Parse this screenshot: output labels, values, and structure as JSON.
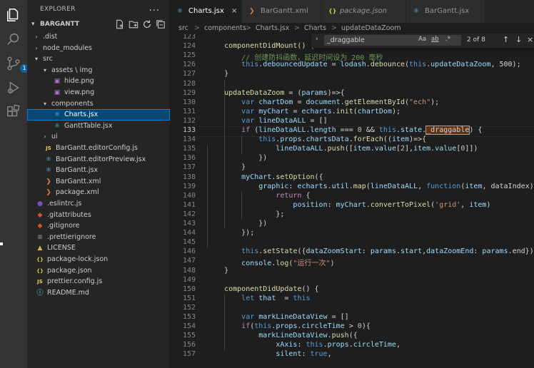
{
  "activity_bar": {
    "icons": [
      "files-icon",
      "search-icon",
      "source-control-icon",
      "run-debug-icon",
      "extensions-icon"
    ],
    "scm_badge": "1"
  },
  "explorer": {
    "title": "EXPLORER",
    "more": "...",
    "project": "BARGANTT",
    "items": [
      {
        "name": ".dist",
        "type": "folder",
        "expanded": false,
        "level": 1
      },
      {
        "name": "node_modules",
        "type": "folder",
        "expanded": false,
        "level": 1
      },
      {
        "name": "src",
        "type": "folder",
        "expanded": true,
        "level": 1
      },
      {
        "name": "assets \\ img",
        "type": "folder",
        "expanded": true,
        "level": 2
      },
      {
        "name": "hide.png",
        "type": "png",
        "level": 3
      },
      {
        "name": "view.png",
        "type": "png",
        "level": 3
      },
      {
        "name": "components",
        "type": "folder",
        "expanded": true,
        "level": 2
      },
      {
        "name": "Charts.jsx",
        "type": "jsx",
        "level": 3,
        "selected": true
      },
      {
        "name": "GanttTable.jsx",
        "type": "jsx",
        "level": 3
      },
      {
        "name": "ui",
        "type": "folder",
        "expanded": false,
        "level": 2
      },
      {
        "name": "BarGantt.editorConfig.js",
        "type": "js",
        "level": 2
      },
      {
        "name": "BarGantt.editorPreview.jsx",
        "type": "jsx",
        "level": 2
      },
      {
        "name": "BarGantt.jsx",
        "type": "jsx",
        "level": 2
      },
      {
        "name": "BarGantt.xml",
        "type": "xml",
        "level": 2
      },
      {
        "name": "package.xml",
        "type": "xml",
        "level": 2
      },
      {
        "name": ".eslintrc.js",
        "type": "eslint",
        "level": 1
      },
      {
        "name": ".gitattributes",
        "type": "git",
        "level": 1
      },
      {
        "name": ".gitignore",
        "type": "git",
        "level": 1
      },
      {
        "name": ".prettierignore",
        "type": "plain",
        "level": 1
      },
      {
        "name": "LICENSE",
        "type": "license",
        "level": 1
      },
      {
        "name": "package-lock.json",
        "type": "json",
        "level": 1
      },
      {
        "name": "package.json",
        "type": "json",
        "level": 1
      },
      {
        "name": "prettier.config.js",
        "type": "js",
        "level": 1
      },
      {
        "name": "README.md",
        "type": "md",
        "level": 1
      }
    ]
  },
  "tabs": [
    {
      "label": "Charts.jsx",
      "icon": "jsx",
      "active": true,
      "close": "×"
    },
    {
      "label": "BarGantt.xml",
      "icon": "xml",
      "active": false
    },
    {
      "label": "package.json",
      "icon": "json",
      "active": false,
      "italic": true
    },
    {
      "label": "BarGantt.jsx",
      "icon": "jsx",
      "active": false
    }
  ],
  "breadcrumb": [
    "src",
    ">",
    "components",
    ">",
    "Charts.jsx",
    ">",
    "Charts",
    ">",
    "updateDataZoom"
  ],
  "find_widget": {
    "value": "_draggable",
    "options": [
      "Aa",
      "ab",
      ".*"
    ],
    "count": "2 of 8",
    "prev": "↑",
    "next": "↓",
    "close": "×"
  },
  "editor": {
    "current_line": "133",
    "lines": [
      {
        "n": "123",
        "t": []
      },
      {
        "n": "124",
        "t": [
          [
            "    componentDidMount() {",
            "fn"
          ]
        ]
      },
      {
        "n": "125",
        "t": [
          [
            "        // 创建防抖函数，延迟时间设为 200 毫秒",
            "cm"
          ]
        ]
      },
      {
        "n": "126",
        "t": [
          [
            "        ",
            "pl"
          ],
          [
            "this",
            "kw"
          ],
          [
            ".",
            "pl"
          ],
          [
            "debouncedUpdate",
            "va"
          ],
          [
            " = ",
            "pl"
          ],
          [
            "lodash",
            "va"
          ],
          [
            ".",
            "pl"
          ],
          [
            "debounce",
            "fn"
          ],
          [
            "(",
            "pl"
          ],
          [
            "this",
            "kw"
          ],
          [
            ".",
            "pl"
          ],
          [
            "updateDataZoom",
            "va"
          ],
          [
            ", 500);",
            "pl"
          ]
        ]
      },
      {
        "n": "127",
        "t": [
          [
            "    }",
            "pl"
          ]
        ]
      },
      {
        "n": "128",
        "t": []
      },
      {
        "n": "129",
        "t": [
          [
            "    ",
            "pl"
          ],
          [
            "updateDataZoom",
            "fn"
          ],
          [
            " = (",
            "pl"
          ],
          [
            "params",
            "va"
          ],
          [
            ")=>{",
            "pl"
          ]
        ]
      },
      {
        "n": "130",
        "t": [
          [
            "        ",
            "pl"
          ],
          [
            "var",
            "kw"
          ],
          [
            " ",
            "pl"
          ],
          [
            "chartDom",
            "va"
          ],
          [
            " = ",
            "pl"
          ],
          [
            "document",
            "va"
          ],
          [
            ".",
            "pl"
          ],
          [
            "getElementById",
            "fn"
          ],
          [
            "(",
            "pl"
          ],
          [
            "\"ech\"",
            "st"
          ],
          [
            ");",
            "pl"
          ]
        ]
      },
      {
        "n": "131",
        "t": [
          [
            "        ",
            "pl"
          ],
          [
            "var",
            "kw"
          ],
          [
            " ",
            "pl"
          ],
          [
            "myChart",
            "va"
          ],
          [
            " = ",
            "pl"
          ],
          [
            "echarts",
            "va"
          ],
          [
            ".",
            "pl"
          ],
          [
            "init",
            "fn"
          ],
          [
            "(",
            "pl"
          ],
          [
            "chartDom",
            "va"
          ],
          [
            ");",
            "pl"
          ]
        ]
      },
      {
        "n": "132",
        "t": [
          [
            "        ",
            "pl"
          ],
          [
            "var",
            "kw"
          ],
          [
            " ",
            "pl"
          ],
          [
            "lineDataALL",
            "va"
          ],
          [
            " = []",
            "pl"
          ]
        ]
      },
      {
        "n": "133",
        "t": [
          [
            "        ",
            "pl"
          ],
          [
            "if",
            "ctl"
          ],
          [
            " (",
            "pl"
          ],
          [
            "lineDataALL",
            "va"
          ],
          [
            ".",
            "pl"
          ],
          [
            "length",
            "va"
          ],
          [
            " === ",
            "pl"
          ],
          [
            "0",
            "nu"
          ],
          [
            " && ",
            "pl"
          ],
          [
            "this",
            "kw"
          ],
          [
            ".",
            "pl"
          ],
          [
            "state",
            "va"
          ],
          [
            ".",
            "pl"
          ],
          [
            "_draggable",
            "match"
          ],
          [
            ") {",
            "pl"
          ]
        ]
      },
      {
        "n": "134",
        "t": [
          [
            "            ",
            "pl"
          ],
          [
            "this",
            "kw"
          ],
          [
            ".",
            "pl"
          ],
          [
            "props",
            "va"
          ],
          [
            ".",
            "pl"
          ],
          [
            "chartsData",
            "va"
          ],
          [
            ".",
            "pl"
          ],
          [
            "forEach",
            "fn"
          ],
          [
            "((",
            "pl"
          ],
          [
            "item",
            "va"
          ],
          [
            ")=>{",
            "pl"
          ]
        ]
      },
      {
        "n": "135",
        "t": [
          [
            "                ",
            "pl"
          ],
          [
            "lineDataALL",
            "va"
          ],
          [
            ".",
            "pl"
          ],
          [
            "push",
            "fn"
          ],
          [
            "([",
            "pl"
          ],
          [
            "item",
            "va"
          ],
          [
            ".",
            "pl"
          ],
          [
            "value",
            "va"
          ],
          [
            "[",
            "pl"
          ],
          [
            "2",
            "nu"
          ],
          [
            "],",
            "pl"
          ],
          [
            "item",
            "va"
          ],
          [
            ".",
            "pl"
          ],
          [
            "value",
            "va"
          ],
          [
            "[",
            "pl"
          ],
          [
            "0",
            "nu"
          ],
          [
            "]])",
            "pl"
          ]
        ]
      },
      {
        "n": "136",
        "t": [
          [
            "            })",
            "pl"
          ]
        ]
      },
      {
        "n": "137",
        "t": [
          [
            "        }",
            "pl"
          ]
        ]
      },
      {
        "n": "138",
        "t": [
          [
            "        ",
            "pl"
          ],
          [
            "myChart",
            "va"
          ],
          [
            ".",
            "pl"
          ],
          [
            "setOption",
            "fn"
          ],
          [
            "({",
            "pl"
          ]
        ]
      },
      {
        "n": "139",
        "t": [
          [
            "            ",
            "pl"
          ],
          [
            "graphic",
            "va"
          ],
          [
            ": ",
            "pl"
          ],
          [
            "echarts",
            "va"
          ],
          [
            ".",
            "pl"
          ],
          [
            "util",
            "va"
          ],
          [
            ".",
            "pl"
          ],
          [
            "map",
            "fn"
          ],
          [
            "(",
            "pl"
          ],
          [
            "lineDataALL",
            "va"
          ],
          [
            ", ",
            "pl"
          ],
          [
            "function",
            "kw"
          ],
          [
            "(",
            "pl"
          ],
          [
            "item",
            "va"
          ],
          [
            ", dataIndex) {",
            "pl"
          ]
        ]
      },
      {
        "n": "140",
        "t": [
          [
            "                ",
            "pl"
          ],
          [
            "return",
            "ctl"
          ],
          [
            " {",
            "pl"
          ]
        ]
      },
      {
        "n": "141",
        "t": [
          [
            "                    ",
            "pl"
          ],
          [
            "position",
            "va"
          ],
          [
            ": ",
            "pl"
          ],
          [
            "myChart",
            "va"
          ],
          [
            ".",
            "pl"
          ],
          [
            "convertToPixel",
            "fn"
          ],
          [
            "(",
            "pl"
          ],
          [
            "'grid'",
            "st"
          ],
          [
            ", ",
            "pl"
          ],
          [
            "item",
            "va"
          ],
          [
            ")",
            "pl"
          ]
        ]
      },
      {
        "n": "142",
        "t": [
          [
            "                };",
            "pl"
          ]
        ]
      },
      {
        "n": "143",
        "t": [
          [
            "            })",
            "pl"
          ]
        ]
      },
      {
        "n": "144",
        "t": [
          [
            "        });",
            "pl"
          ]
        ]
      },
      {
        "n": "145",
        "t": []
      },
      {
        "n": "146",
        "t": [
          [
            "        ",
            "pl"
          ],
          [
            "this",
            "kw"
          ],
          [
            ".",
            "pl"
          ],
          [
            "setState",
            "fn"
          ],
          [
            "({",
            "pl"
          ],
          [
            "dataZoomStart",
            "va"
          ],
          [
            ": ",
            "pl"
          ],
          [
            "params",
            "va"
          ],
          [
            ".",
            "pl"
          ],
          [
            "start",
            "va"
          ],
          [
            ",",
            "pl"
          ],
          [
            "dataZoomEnd",
            "va"
          ],
          [
            ": ",
            "pl"
          ],
          [
            "params",
            "va"
          ],
          [
            ".end});",
            "pl"
          ]
        ]
      },
      {
        "n": "147",
        "t": [
          [
            "        ",
            "pl"
          ],
          [
            "console",
            "va"
          ],
          [
            ".",
            "pl"
          ],
          [
            "log",
            "fn"
          ],
          [
            "(",
            "pl"
          ],
          [
            "\"运行一次\"",
            "st"
          ],
          [
            ")",
            "pl"
          ]
        ]
      },
      {
        "n": "148",
        "t": [
          [
            "    }",
            "pl"
          ]
        ]
      },
      {
        "n": "149",
        "t": []
      },
      {
        "n": "150",
        "t": [
          [
            "    ",
            "pl"
          ],
          [
            "componentDidUpdate",
            "fn"
          ],
          [
            "() {",
            "pl"
          ]
        ]
      },
      {
        "n": "151",
        "t": [
          [
            "        ",
            "pl"
          ],
          [
            "let",
            "kw"
          ],
          [
            " ",
            "pl"
          ],
          [
            "that",
            "va"
          ],
          [
            "  = ",
            "pl"
          ],
          [
            "this",
            "kw"
          ]
        ]
      },
      {
        "n": "152",
        "t": []
      },
      {
        "n": "153",
        "t": [
          [
            "        ",
            "pl"
          ],
          [
            "var",
            "kw"
          ],
          [
            " ",
            "pl"
          ],
          [
            "markLineDataView",
            "va"
          ],
          [
            " = []",
            "pl"
          ]
        ]
      },
      {
        "n": "154",
        "t": [
          [
            "        ",
            "pl"
          ],
          [
            "if",
            "ctl"
          ],
          [
            "(",
            "pl"
          ],
          [
            "this",
            "kw"
          ],
          [
            ".",
            "pl"
          ],
          [
            "props",
            "va"
          ],
          [
            ".",
            "pl"
          ],
          [
            "circleTime",
            "va"
          ],
          [
            " > ",
            "pl"
          ],
          [
            "0",
            "nu"
          ],
          [
            "){",
            "pl"
          ]
        ]
      },
      {
        "n": "155",
        "t": [
          [
            "            ",
            "pl"
          ],
          [
            "markLineDataView",
            "va"
          ],
          [
            ".",
            "pl"
          ],
          [
            "push",
            "fn"
          ],
          [
            "({",
            "pl"
          ]
        ]
      },
      {
        "n": "156",
        "t": [
          [
            "                ",
            "pl"
          ],
          [
            "xAxis",
            "va"
          ],
          [
            ": ",
            "pl"
          ],
          [
            "this",
            "kw"
          ],
          [
            ".",
            "pl"
          ],
          [
            "props",
            "va"
          ],
          [
            ".",
            "pl"
          ],
          [
            "circleTime",
            "va"
          ],
          [
            ",",
            "pl"
          ]
        ]
      },
      {
        "n": "157",
        "t": [
          [
            "                ",
            "pl"
          ],
          [
            "silent",
            "va"
          ],
          [
            ": ",
            "pl"
          ],
          [
            "true",
            "kw"
          ],
          [
            ",",
            "pl"
          ]
        ]
      }
    ]
  },
  "colors": {
    "keyword": "#569cd6",
    "control": "#c586c0",
    "function": "#dcdcaa",
    "variable": "#9cdcfe",
    "string": "#ce9178",
    "number": "#b5cea8",
    "comment": "#6a9955",
    "plain": "#d4d4d4",
    "folder": "#cccccc",
    "jsx": "#4fc1ff",
    "js": "#e8d44d",
    "xml": "#e37933",
    "json": "#cbcb41",
    "png": "#a074c4",
    "git": "#e44d26",
    "md": "#519aba",
    "eslint": "#7a4fc4"
  }
}
